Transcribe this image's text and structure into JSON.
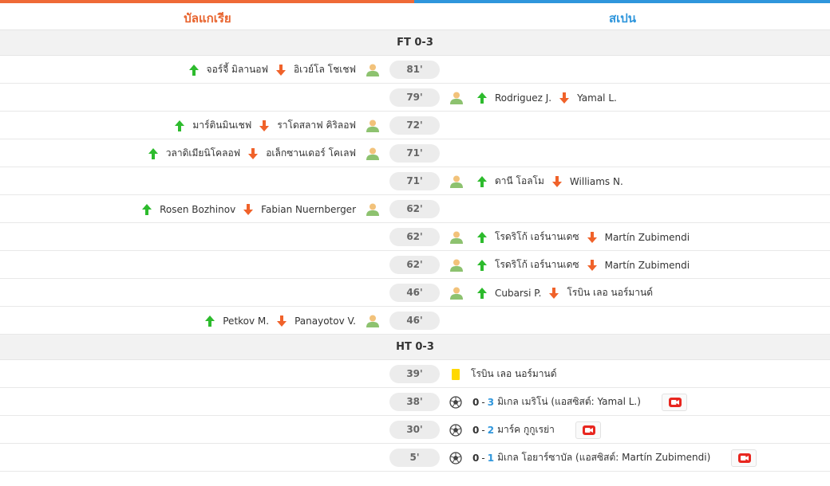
{
  "teams": {
    "home": "บัลแกเรีย",
    "away": "สเปน"
  },
  "colors": {
    "home": "#e8642e",
    "away": "#2f96dc",
    "in_arrow": "#2dbb2d",
    "out_arrow": "#f0622a",
    "card": "#ffd800",
    "video": "#e8261f"
  },
  "sections": {
    "ft": "FT 0-3",
    "ht": "HT 0-3"
  },
  "events": [
    {
      "minute": "81'",
      "side": "home",
      "type": "sub",
      "in": "จอร์จี้ มิลานอฟ",
      "out": "อิเวย์โล โชเชฟ"
    },
    {
      "minute": "79'",
      "side": "away",
      "type": "sub",
      "in": "Rodriguez J.",
      "out": "Yamal L."
    },
    {
      "minute": "72'",
      "side": "home",
      "type": "sub",
      "in": "มาร์ตินมินเชฟ",
      "out": "ราโดสลาฟ คิริลอฟ"
    },
    {
      "minute": "71'",
      "side": "home",
      "type": "sub",
      "in": "วลาดิเมียนิโคลอฟ",
      "out": "อเล็กซานเดอร์ โคเลฟ"
    },
    {
      "minute": "71'",
      "side": "away",
      "type": "sub",
      "in": "ดานี โอลโม",
      "out": "Williams N."
    },
    {
      "minute": "62'",
      "side": "home",
      "type": "sub",
      "in": "Rosen Bozhinov",
      "out": "Fabian Nuernberger"
    },
    {
      "minute": "62'",
      "side": "away",
      "type": "sub",
      "in": "โรดริโก้ เอร์นานเดซ",
      "out": "Martín Zubimendi"
    },
    {
      "minute": "62'",
      "side": "away",
      "type": "sub",
      "in": "โรดริโก้ เอร์นานเดซ",
      "out": "Martín Zubimendi"
    },
    {
      "minute": "46'",
      "side": "away",
      "type": "sub",
      "in": "Cubarsi P.",
      "out": "โรบิน เลอ นอร์มานด์"
    },
    {
      "minute": "46'",
      "side": "home",
      "type": "sub",
      "in": "Petkov M.",
      "out": "Panayotov V."
    },
    {
      "minute": "39'",
      "side": "away",
      "type": "card",
      "player": "โรบิน เลอ นอร์มานด์"
    },
    {
      "minute": "38'",
      "side": "away",
      "type": "goal",
      "home_score": "0",
      "away_score": "3",
      "text": "มิเกล เมริโน่ (แอสซิสต์: Yamal L.)"
    },
    {
      "minute": "30'",
      "side": "away",
      "type": "goal",
      "home_score": "0",
      "away_score": "2",
      "text": "มาร์ค กูกูเรย่า"
    },
    {
      "minute": "5'",
      "side": "away",
      "type": "goal",
      "home_score": "0",
      "away_score": "1",
      "text": "มิเกล โอยาร์ซาบัล (แอสซิสต์: Martín Zubimendi)"
    }
  ]
}
